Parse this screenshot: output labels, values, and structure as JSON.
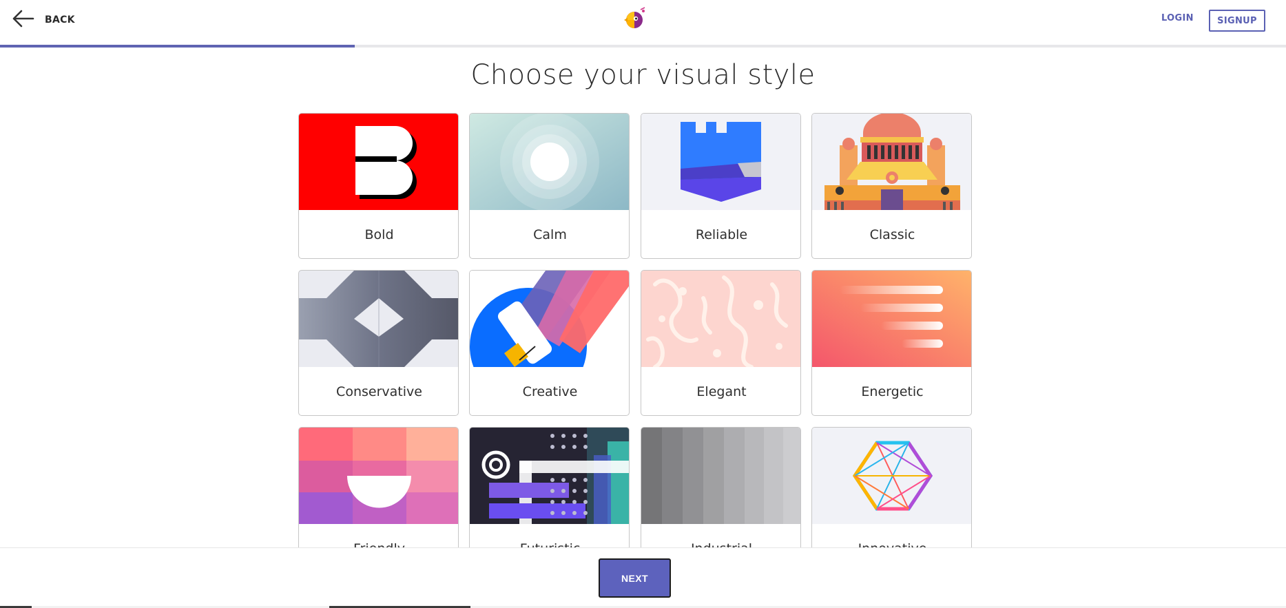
{
  "header": {
    "back_label": "BACK",
    "login_label": "LOGIN",
    "signup_label": "SIGNUP",
    "brand_color": "#5a60b3"
  },
  "progress": {
    "fraction": 0.276
  },
  "main": {
    "title": "Choose your visual style",
    "styles": [
      {
        "label": "Bold",
        "image": "bold-b-graphic"
      },
      {
        "label": "Calm",
        "image": "calm-circles-graphic"
      },
      {
        "label": "Reliable",
        "image": "reliable-shield-graphic"
      },
      {
        "label": "Classic",
        "image": "classic-building-graphic"
      },
      {
        "label": "Conservative",
        "image": "conservative-geometric-graphic"
      },
      {
        "label": "Creative",
        "image": "creative-paint-roller-graphic"
      },
      {
        "label": "Elegant",
        "image": "elegant-damask-graphic"
      },
      {
        "label": "Energetic",
        "image": "energetic-lines-graphic"
      },
      {
        "label": "Friendly",
        "image": "friendly-smile-graphic"
      },
      {
        "label": "Futuristic",
        "image": "futuristic-dots-graphic"
      },
      {
        "label": "Industrial",
        "image": "industrial-metal-graphic"
      },
      {
        "label": "Innovative",
        "image": "innovative-hexagon-graphic"
      }
    ]
  },
  "footer": {
    "next_label": "NEXT",
    "next_color": "#5d62bd"
  }
}
